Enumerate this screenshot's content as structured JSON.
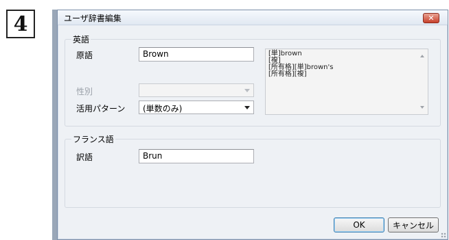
{
  "step_number": "4",
  "window": {
    "title": "ユーザ辞書編集",
    "close_glyph": "✕"
  },
  "english_group": {
    "legend": "英語",
    "source_label": "原語",
    "source_value": "Brown",
    "gender_label": "性別",
    "gender_value": "",
    "pattern_label": "活用パターン",
    "pattern_value": "(単数のみ)",
    "inflections": [
      "[単]brown",
      "[複]",
      "[所有格][単]brown's",
      "[所有格][複]"
    ]
  },
  "french_group": {
    "legend": "フランス語",
    "translation_label": "訳語",
    "translation_value": "Brun"
  },
  "buttons": {
    "ok": "OK",
    "cancel": "キャンセル"
  }
}
